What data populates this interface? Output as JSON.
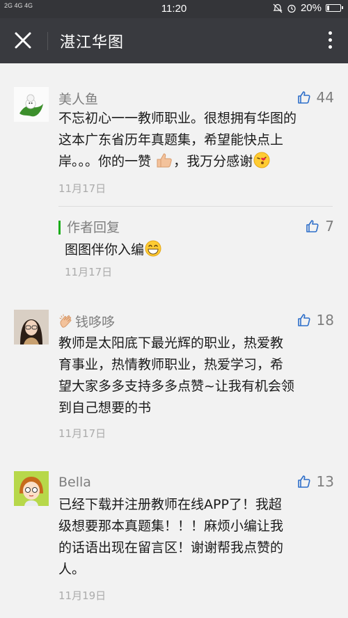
{
  "status_bar": {
    "signal": "2G 4G 4G",
    "time": "11:20",
    "battery": "20%",
    "battery_level": 0.2
  },
  "header": {
    "title": "湛江华图"
  },
  "comments": [
    {
      "name": "美人鱼",
      "likes": "44",
      "text_lines": [
        "不忘初心一一教师职业。很想拥有华图的",
        "这本广东省历年真题集，希望能快点上",
        "岸。。。你的一赞",
        "，我万分感谢"
      ],
      "date": "11月17日",
      "reply": {
        "label": "作者回复",
        "likes": "7",
        "text": "图图伴你入编",
        "date": "11月17日"
      }
    },
    {
      "name": "钱哆哆",
      "likes": "18",
      "text_lines": [
        "教师是太阳底下最光辉的职业，热爱教",
        "育事业，热情教师职业，热爱学习，希",
        "望大家多多支持多多点赞~让我有机会领",
        "到自己想要的书"
      ],
      "date": "11月17日"
    },
    {
      "name": "Bella",
      "likes": "13",
      "text_lines": [
        "已经下载并注册教师在线APP了！我超",
        "级想要那本真题集！！！麻烦小编让我",
        "的话语出现在留言区！谢谢帮我点赞的",
        "人。"
      ],
      "date": "11月19日"
    }
  ],
  "icons": [
    "close-icon",
    "more-icon",
    "thumbs-up-icon",
    "alarm-icon",
    "bell-off-icon"
  ]
}
